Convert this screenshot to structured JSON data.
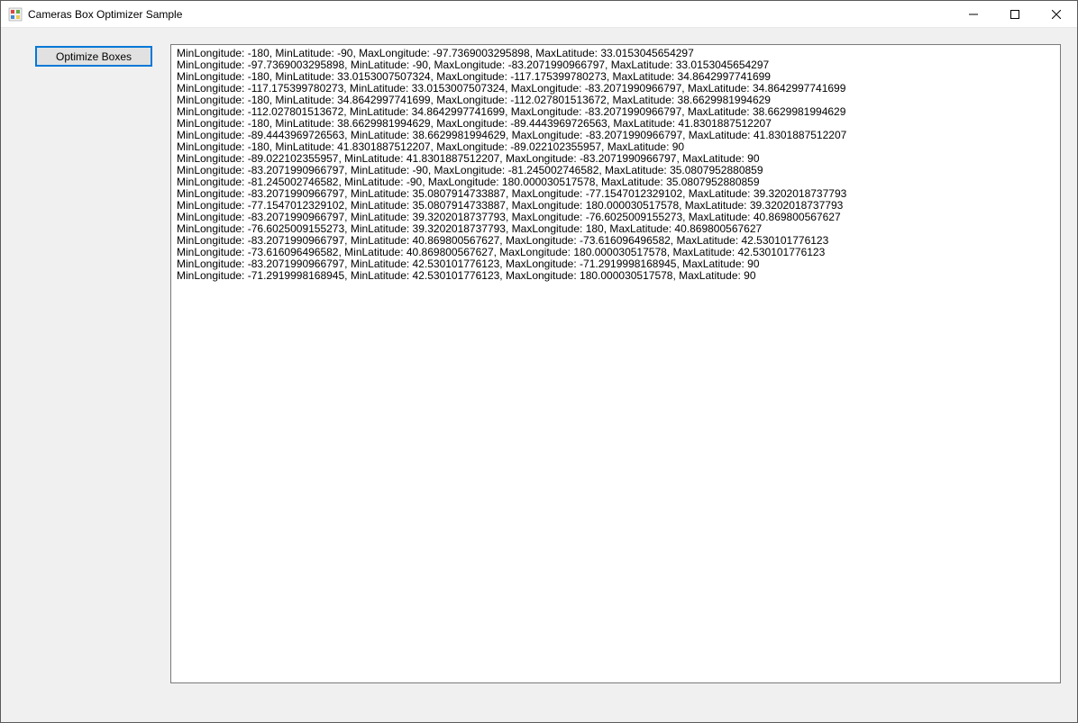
{
  "window": {
    "title": "Cameras Box Optimizer Sample"
  },
  "controls": {
    "optimize_button_label": "Optimize Boxes"
  },
  "output_lines": [
    "MinLongitude: -180, MinLatitude: -90, MaxLongitude: -97.7369003295898, MaxLatitude: 33.0153045654297",
    "MinLongitude: -97.7369003295898, MinLatitude: -90, MaxLongitude: -83.2071990966797, MaxLatitude: 33.0153045654297",
    "MinLongitude: -180, MinLatitude: 33.0153007507324, MaxLongitude: -117.175399780273, MaxLatitude: 34.8642997741699",
    "MinLongitude: -117.175399780273, MinLatitude: 33.0153007507324, MaxLongitude: -83.2071990966797, MaxLatitude: 34.8642997741699",
    "MinLongitude: -180, MinLatitude: 34.8642997741699, MaxLongitude: -112.027801513672, MaxLatitude: 38.6629981994629",
    "MinLongitude: -112.027801513672, MinLatitude: 34.8642997741699, MaxLongitude: -83.2071990966797, MaxLatitude: 38.6629981994629",
    "MinLongitude: -180, MinLatitude: 38.6629981994629, MaxLongitude: -89.4443969726563, MaxLatitude: 41.8301887512207",
    "MinLongitude: -89.4443969726563, MinLatitude: 38.6629981994629, MaxLongitude: -83.2071990966797, MaxLatitude: 41.8301887512207",
    "MinLongitude: -180, MinLatitude: 41.8301887512207, MaxLongitude: -89.022102355957, MaxLatitude: 90",
    "MinLongitude: -89.022102355957, MinLatitude: 41.8301887512207, MaxLongitude: -83.2071990966797, MaxLatitude: 90",
    "MinLongitude: -83.2071990966797, MinLatitude: -90, MaxLongitude: -81.245002746582, MaxLatitude: 35.0807952880859",
    "MinLongitude: -81.245002746582, MinLatitude: -90, MaxLongitude: 180.000030517578, MaxLatitude: 35.0807952880859",
    "MinLongitude: -83.2071990966797, MinLatitude: 35.0807914733887, MaxLongitude: -77.1547012329102, MaxLatitude: 39.3202018737793",
    "MinLongitude: -77.1547012329102, MinLatitude: 35.0807914733887, MaxLongitude: 180.000030517578, MaxLatitude: 39.3202018737793",
    "MinLongitude: -83.2071990966797, MinLatitude: 39.3202018737793, MaxLongitude: -76.6025009155273, MaxLatitude: 40.869800567627",
    "MinLongitude: -76.6025009155273, MinLatitude: 39.3202018737793, MaxLongitude: 180, MaxLatitude: 40.869800567627",
    "MinLongitude: -83.2071990966797, MinLatitude: 40.869800567627, MaxLongitude: -73.616096496582, MaxLatitude: 42.530101776123",
    "MinLongitude: -73.616096496582, MinLatitude: 40.869800567627, MaxLongitude: 180.000030517578, MaxLatitude: 42.530101776123",
    "MinLongitude: -83.2071990966797, MinLatitude: 42.530101776123, MaxLongitude: -71.2919998168945, MaxLatitude: 90",
    "MinLongitude: -71.2919998168945, MinLatitude: 42.530101776123, MaxLongitude: 180.000030517578, MaxLatitude: 90"
  ]
}
